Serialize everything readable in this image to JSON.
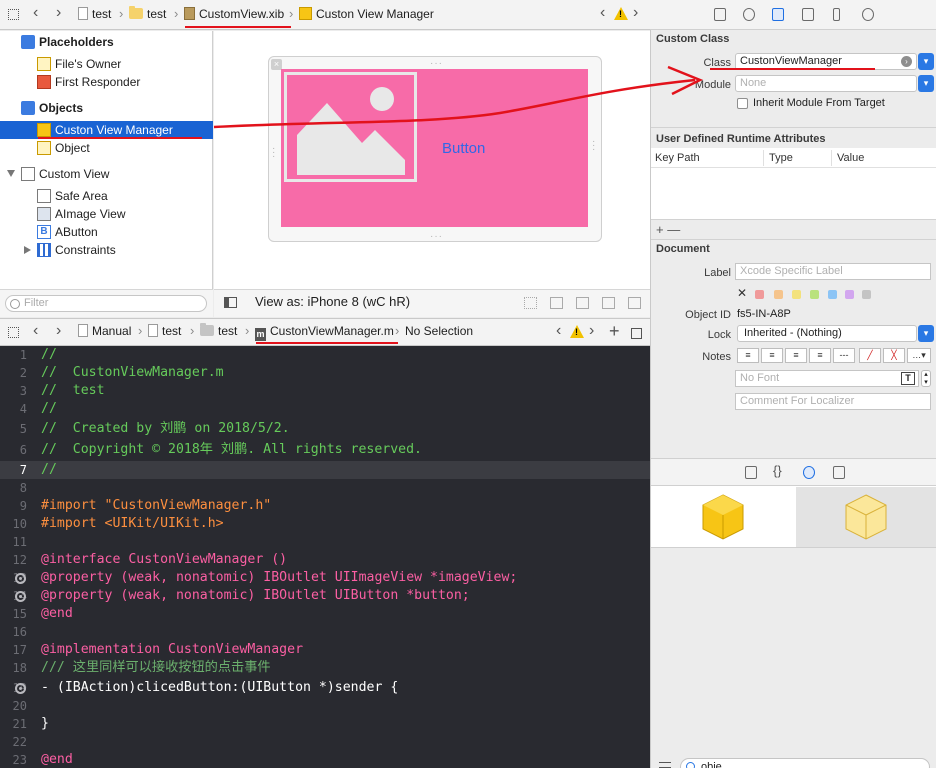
{
  "topbar": {
    "crumbs": [
      "test",
      "test",
      "CustomView.xib",
      "Custon View Manager"
    ]
  },
  "outline": {
    "placeholders_label": "Placeholders",
    "files_owner": "File's Owner",
    "first_responder": "First Responder",
    "objects_label": "Objects",
    "custon_view_manager": "Custon View Manager",
    "object": "Object",
    "custom_view": "Custom View",
    "safe_area": "Safe Area",
    "aimage_view": "AImage View",
    "abutton": "AButton",
    "constraints": "Constraints",
    "filter_placeholder": "Filter"
  },
  "canvas": {
    "button_label": "Button",
    "view_as": "View as: iPhone 8 (wC hR)"
  },
  "editor_bar": {
    "crumbs": [
      "Manual",
      "test",
      "test",
      "CustonViewManager.m",
      "No Selection"
    ]
  },
  "code": {
    "lines": [
      "//",
      "//  CustonViewManager.m",
      "//  test",
      "//",
      "//  Created by 刘鹏 on 2018/5/2.",
      "//  Copyright © 2018年 刘鹏. All rights reserved.",
      "//",
      "",
      "#import \"CustonViewManager.h\"",
      "#import <UIKit/UIKit.h>",
      "",
      "@interface CustonViewManager ()",
      "@property (weak, nonatomic) IBOutlet UIImageView *imageView;",
      "@property (weak, nonatomic) IBOutlet UIButton *button;",
      "@end",
      "",
      "@implementation CustonViewManager",
      "/// 这里同样可以接收按钮的点击事件",
      "- (IBAction)clicedButton:(UIButton *)sender {",
      "",
      "}",
      "",
      "@end"
    ],
    "line_numbers": [
      "1",
      "2",
      "3",
      "4",
      "5",
      "6",
      "7",
      "8",
      "9",
      "10",
      "11",
      "12",
      "13",
      "14",
      "15",
      "16",
      "17",
      "18",
      "19",
      "20",
      "21",
      "22",
      "23"
    ]
  },
  "inspector": {
    "custom_class_title": "Custom Class",
    "class_label": "Class",
    "class_value": "CustonViewManager",
    "module_label": "Module",
    "module_placeholder": "None",
    "inherit_label": "Inherit Module From Target",
    "udra_title": "User Defined Runtime Attributes",
    "col_keypath": "Key Path",
    "col_type": "Type",
    "col_value": "Value",
    "add_remove": "+  —",
    "document_title": "Document",
    "label_label": "Label",
    "label_placeholder": "Xcode Specific Label",
    "object_id_label": "Object ID",
    "object_id_value": "fs5-IN-A8P",
    "lock_label": "Lock",
    "lock_value": "Inherited - (Nothing)",
    "notes_label": "Notes",
    "font_placeholder": "No Font",
    "comment_placeholder": "Comment For Localizer",
    "lib_search_value": "obje"
  },
  "colors": {
    "selection": "#1963d3",
    "pink_view": "#f76ba8",
    "button_text": "#3267e6",
    "editor_bg": "#292a30",
    "annotation": "#e2121b"
  }
}
